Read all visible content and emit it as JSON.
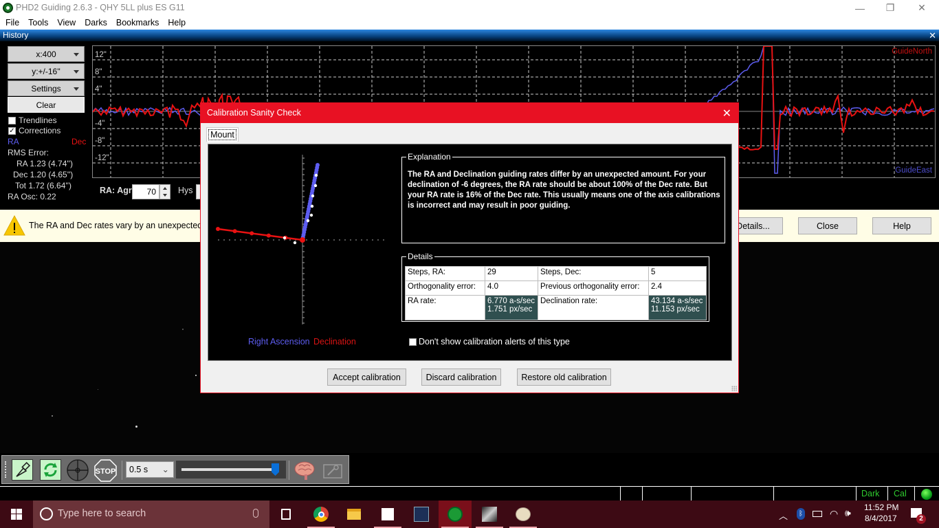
{
  "window": {
    "title": "PHD2 Guiding 2.6.3 - QHY 5LL plus ES G11",
    "controls": {
      "minimize": "—",
      "restore": "❐",
      "close": "✕"
    }
  },
  "menu": [
    "File",
    "Tools",
    "View",
    "Darks",
    "Bookmarks",
    "Help"
  ],
  "history": {
    "title": "History",
    "close_icon": "✕",
    "x_scale": "x:400",
    "y_scale": "y:+/-16''",
    "settings": "Settings",
    "clear": "Clear",
    "trendlines": {
      "label": "Trendlines",
      "checked": false
    },
    "corrections": {
      "label": "Corrections",
      "checked": true
    },
    "legend_ra": "RA",
    "legend_dec": "Dec",
    "rms_title": "RMS Error:",
    "rms_ra": "RA  1.23 (4.74'')",
    "rms_dec": "Dec  1.20 (4.65'')",
    "rms_tot": "Tot  1.72 (6.64'')",
    "ra_osc": "RA Osc: 0.22",
    "y_ticks": [
      "12\"",
      "8\"",
      "4\"",
      "-4\"",
      "-8\"",
      "-12\""
    ],
    "label_north": "GuideNorth",
    "label_east": "GuideEast",
    "ra_agr_label": "RA: Agr",
    "ra_agr_value": "70",
    "hys_label": "Hys",
    "colors": {
      "ra": "#5d5df0",
      "dec": "#e81212"
    }
  },
  "infobar": {
    "message": "The RA and Dec rates vary by an unexpected amount. A calibration issue may be present.",
    "details": "Details...",
    "close": "Close",
    "help": "Help"
  },
  "toolbar": {
    "exposure": "0.5 s",
    "exposure_slider_fraction": 0.97
  },
  "statusbar": {
    "dark": "Dark",
    "cal": "Cal"
  },
  "taskbar": {
    "search_placeholder": "Type here to search",
    "time": "11:52 PM",
    "date": "8/4/2017",
    "notification_count": "2"
  },
  "dialog": {
    "title": "Calibration Sanity Check",
    "tab": "Mount",
    "legend_ra": "Right Ascension",
    "legend_dec": "Declination",
    "explanation_label": "Explanation",
    "explanation": "The RA and Declination guiding rates differ by an unexpected amount.  For your declination of -6 degrees, the RA rate should be about 100% of the Dec rate.  But your RA rate is 16% of the Dec rate.  This usually means one of the axis calibrations is incorrect and may result in poor guiding.",
    "details_label": "Details",
    "details": {
      "steps_ra_label": "Steps, RA:",
      "steps_ra": "29",
      "steps_dec_label": "Steps, Dec:",
      "steps_dec": "5",
      "ortho_label": "Orthogonality error:",
      "ortho": "4.0",
      "prev_ortho_label": "Previous orthogonality error:",
      "prev_ortho": "2.4",
      "ra_rate_label": "RA rate:",
      "ra_rate_as": "6.770 a-s/sec",
      "ra_rate_px": "1.751 px/sec",
      "dec_rate_label": "Declination rate:",
      "dec_rate_as": "43.134 a-s/sec",
      "dec_rate_px": "11.153 px/sec"
    },
    "dont_show": {
      "label": "Don't show calibration alerts of this type",
      "checked": false
    },
    "accept": "Accept calibration",
    "discard": "Discard calibration",
    "restore": "Restore old calibration"
  }
}
